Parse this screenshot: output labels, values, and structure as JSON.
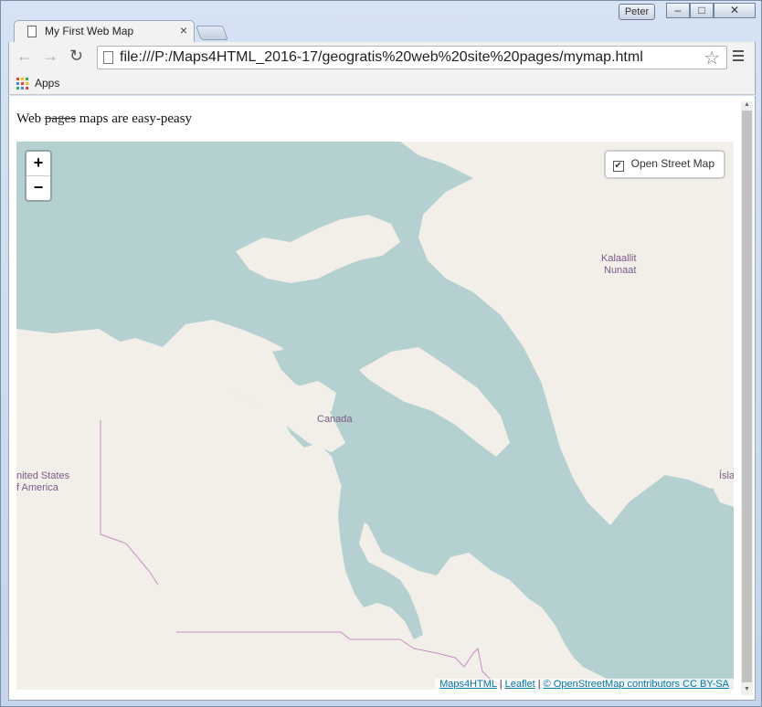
{
  "window": {
    "profile_name": "Peter",
    "minimize": "–",
    "restore": "□",
    "close": "✕"
  },
  "tab": {
    "title": "My First Web Map",
    "close": "×"
  },
  "toolbar": {
    "url": "file:///P:/Maps4HTML_2016-17/geogratis%20web%20site%20pages/mymap.html",
    "back": "←",
    "forward": "→",
    "reload": "↻",
    "star": "☆"
  },
  "bookmarks": {
    "apps_label": "Apps"
  },
  "page": {
    "heading_start": "Web",
    "heading_struck": "pages",
    "heading_end": "maps are easy-peasy"
  },
  "map": {
    "zoom_in": "+",
    "zoom_out": "−",
    "layer_checkbox": "✔",
    "layer_name": "Open Street Map",
    "labels": {
      "canada": "Canada",
      "greenland_1": "Kalaallit",
      "greenland_2": "Nunaat",
      "usa_1": "nited States",
      "usa_2": "f America",
      "iceland": "Ísla"
    },
    "attribution": {
      "maps4html": "Maps4HTML",
      "sep1": " | ",
      "leaflet": "Leaflet",
      "sep2": " | ",
      "osm": "© OpenStreetMap contributors CC BY-SA"
    },
    "colors": {
      "water": "#b5d0d0",
      "land": "#f2efe9",
      "border": "#c98bc4"
    }
  }
}
